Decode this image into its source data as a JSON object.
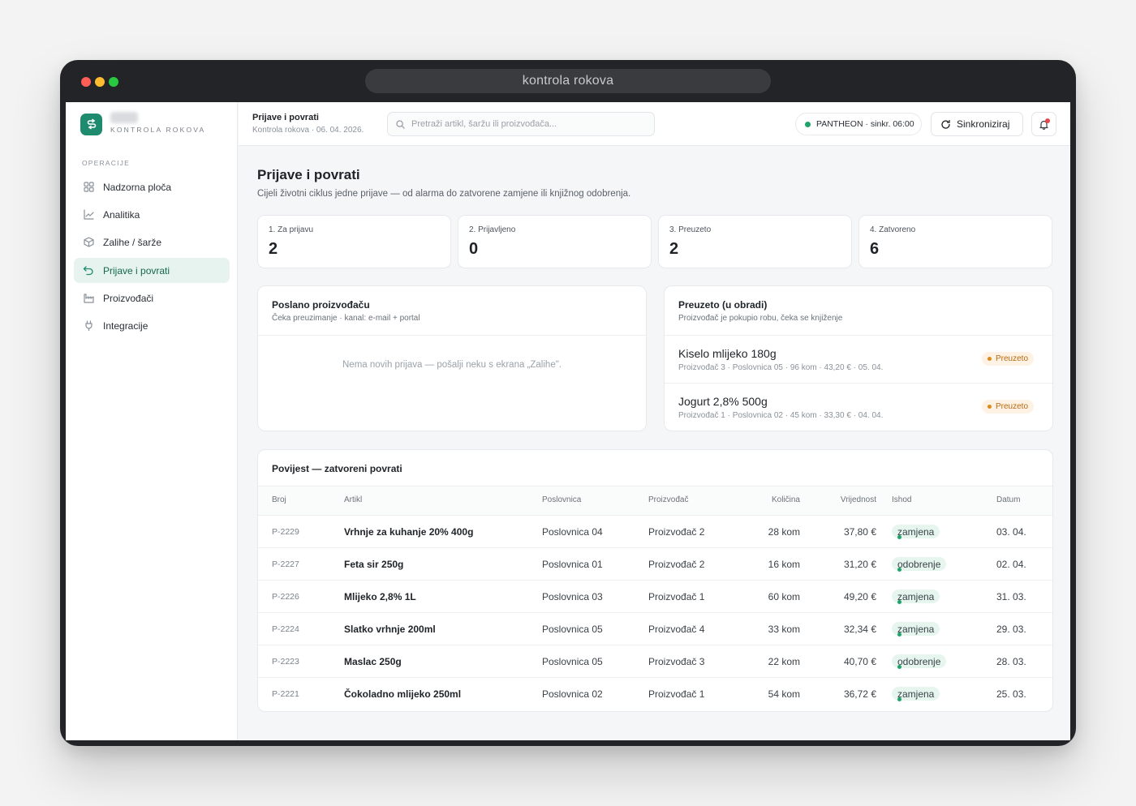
{
  "window": {
    "url_title": "kontrola rokova"
  },
  "sidebar": {
    "brand_subtitle": "KONTROLA ROKOVA",
    "section_label": "OPERACIJE",
    "items": [
      {
        "label": "Nadzorna ploča",
        "icon": "grid-icon"
      },
      {
        "label": "Analitika",
        "icon": "chart-line-icon"
      },
      {
        "label": "Zalihe / šarže",
        "icon": "box-icon"
      },
      {
        "label": "Prijave i povrati",
        "icon": "return-arrow-icon",
        "active": true
      },
      {
        "label": "Proizvođači",
        "icon": "factory-icon"
      },
      {
        "label": "Integracije",
        "icon": "plug-icon"
      }
    ]
  },
  "topbar": {
    "title": "Prijave i povrati",
    "subtitle": "Kontrola rokova · 06. 04. 2026.",
    "search_placeholder": "Pretraži artikl, šaržu ili proizvođača...",
    "sync_status": "PANTHEON · sinkr. 06:00",
    "sync_button": "Sinkroniziraj"
  },
  "page": {
    "title": "Prijave i povrati",
    "subtitle": "Cijeli životni ciklus jedne prijave — od alarma do zatvorene zamjene ili knjižnog odobrenja."
  },
  "stats": [
    {
      "label": "1. Za prijavu",
      "value": "2"
    },
    {
      "label": "2. Prijavljeno",
      "value": "0"
    },
    {
      "label": "3. Preuzeto",
      "value": "2"
    },
    {
      "label": "4. Zatvoreno",
      "value": "6"
    }
  ],
  "sent_card": {
    "title": "Poslano proizvođaču",
    "subtitle": "Čeka preuzimanje · kanal: e-mail + portal",
    "empty_text": "Nema novih prijava — pošalji neku s ekrana „Zalihe\"."
  },
  "picked_card": {
    "title": "Preuzeto (u obradi)",
    "subtitle": "Proizvođač je pokupio robu, čeka se knjiženje",
    "items": [
      {
        "name": "Kiselo mlijeko 180g",
        "meta": "Proizvođač 3 · Poslovnica 05 · 96 kom · 43,20 € · 05. 04.",
        "status": "Preuzeto"
      },
      {
        "name": "Jogurt 2,8% 500g",
        "meta": "Proizvođač 1 · Poslovnica 02 · 45 kom · 33,30 € · 04. 04.",
        "status": "Preuzeto"
      }
    ]
  },
  "history": {
    "title": "Povijest — zatvoreni povrati",
    "columns": [
      "Broj",
      "Artikl",
      "Poslovnica",
      "Proizvođač",
      "Količina",
      "Vrijednost",
      "Ishod",
      "Datum"
    ],
    "rows": [
      {
        "broj": "P-2229",
        "artikl": "Vrhnje za kuhanje 20% 400g",
        "poslovnica": "Poslovnica 04",
        "proizvodac": "Proizvođač 2",
        "kolicina": "28 kom",
        "vrijednost": "37,80 €",
        "ishod": "zamjena",
        "datum": "03. 04."
      },
      {
        "broj": "P-2227",
        "artikl": "Feta sir 250g",
        "poslovnica": "Poslovnica 01",
        "proizvodac": "Proizvođač 2",
        "kolicina": "16 kom",
        "vrijednost": "31,20 €",
        "ishod": "odobrenje",
        "datum": "02. 04."
      },
      {
        "broj": "P-2226",
        "artikl": "Mlijeko 2,8% 1L",
        "poslovnica": "Poslovnica 03",
        "proizvodac": "Proizvođač 1",
        "kolicina": "60 kom",
        "vrijednost": "49,20 €",
        "ishod": "zamjena",
        "datum": "31. 03."
      },
      {
        "broj": "P-2224",
        "artikl": "Slatko vrhnje 200ml",
        "poslovnica": "Poslovnica 05",
        "proizvodac": "Proizvođač 4",
        "kolicina": "33 kom",
        "vrijednost": "32,34 €",
        "ishod": "zamjena",
        "datum": "29. 03."
      },
      {
        "broj": "P-2223",
        "artikl": "Maslac 250g",
        "poslovnica": "Poslovnica 05",
        "proizvodac": "Proizvođač 3",
        "kolicina": "22 kom",
        "vrijednost": "40,70 €",
        "ishod": "odobrenje",
        "datum": "28. 03."
      },
      {
        "broj": "P-2221",
        "artikl": "Čokoladno mlijeko 250ml",
        "poslovnica": "Poslovnica 02",
        "proizvodac": "Proizvođač 1",
        "kolicina": "54 kom",
        "vrijednost": "36,72 €",
        "ishod": "zamjena",
        "datum": "25. 03."
      }
    ]
  },
  "colors": {
    "accent": "#1e8a6e",
    "status_orange": "#e08a1e",
    "status_green": "#1fa36b"
  }
}
